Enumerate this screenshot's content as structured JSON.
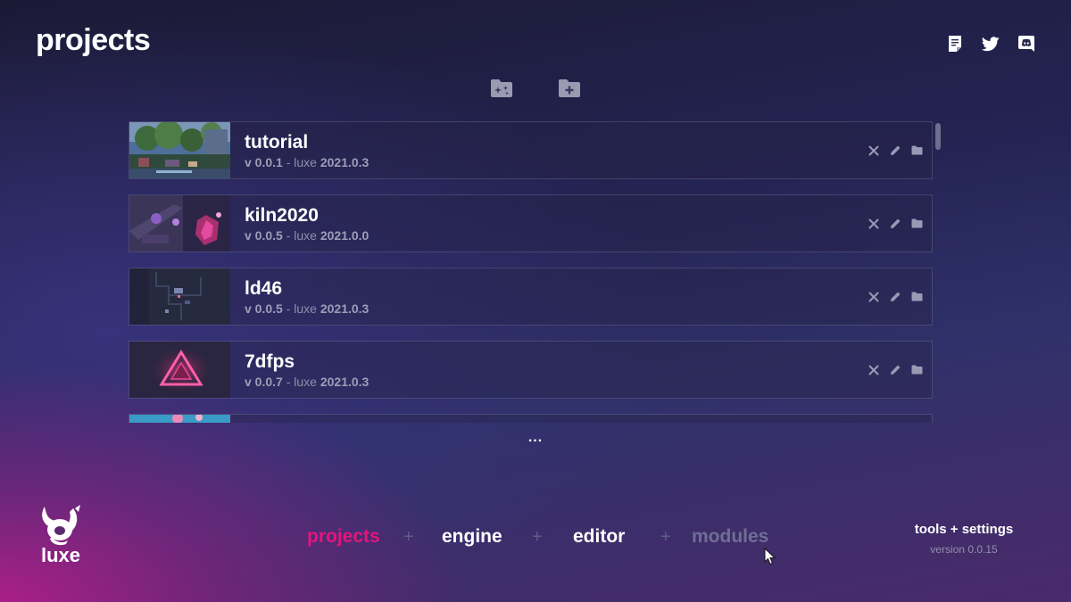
{
  "page": {
    "title": "projects"
  },
  "header_icons": [
    "notes-icon",
    "twitter-icon",
    "discord-icon"
  ],
  "folder_actions": [
    "new-project-icon",
    "add-project-icon"
  ],
  "projects": [
    {
      "name": "tutorial",
      "version_prefix": "v 0.0.1",
      "separator": " - luxe ",
      "engine_version": "2021.0.3",
      "thumbnail": "tutorial-thumbnail"
    },
    {
      "name": "kiln2020",
      "version_prefix": "v 0.0.5",
      "separator": " - luxe ",
      "engine_version": "2021.0.0",
      "thumbnail": "kiln2020-thumbnail"
    },
    {
      "name": "ld46",
      "version_prefix": "v 0.0.5",
      "separator": " - luxe ",
      "engine_version": "2021.0.3",
      "thumbnail": "ld46-thumbnail"
    },
    {
      "name": "7dfps",
      "version_prefix": "v 0.0.7",
      "separator": " - luxe ",
      "engine_version": "2021.0.3",
      "thumbnail": "7dfps-thumbnail"
    }
  ],
  "card_actions": [
    "close-icon",
    "edit-icon",
    "folder-icon"
  ],
  "list_more": "...",
  "logo": {
    "text": "luxe"
  },
  "nav": {
    "items": [
      {
        "label": "projects",
        "state": "active"
      },
      {
        "label": "engine",
        "state": "normal"
      },
      {
        "label": "editor",
        "state": "normal"
      },
      {
        "label": "modules",
        "state": "disabled"
      }
    ],
    "separator": "+"
  },
  "tools": {
    "label": "tools + settings",
    "version": "version 0.0.15"
  },
  "colors": {
    "accent": "#e4157a",
    "nav_active": "#e4157a",
    "nav_normal": "#ffffff",
    "nav_disabled": "#6f6f95",
    "background_top": "#1b1a35",
    "background_bottom_left": "#b01e8a"
  }
}
